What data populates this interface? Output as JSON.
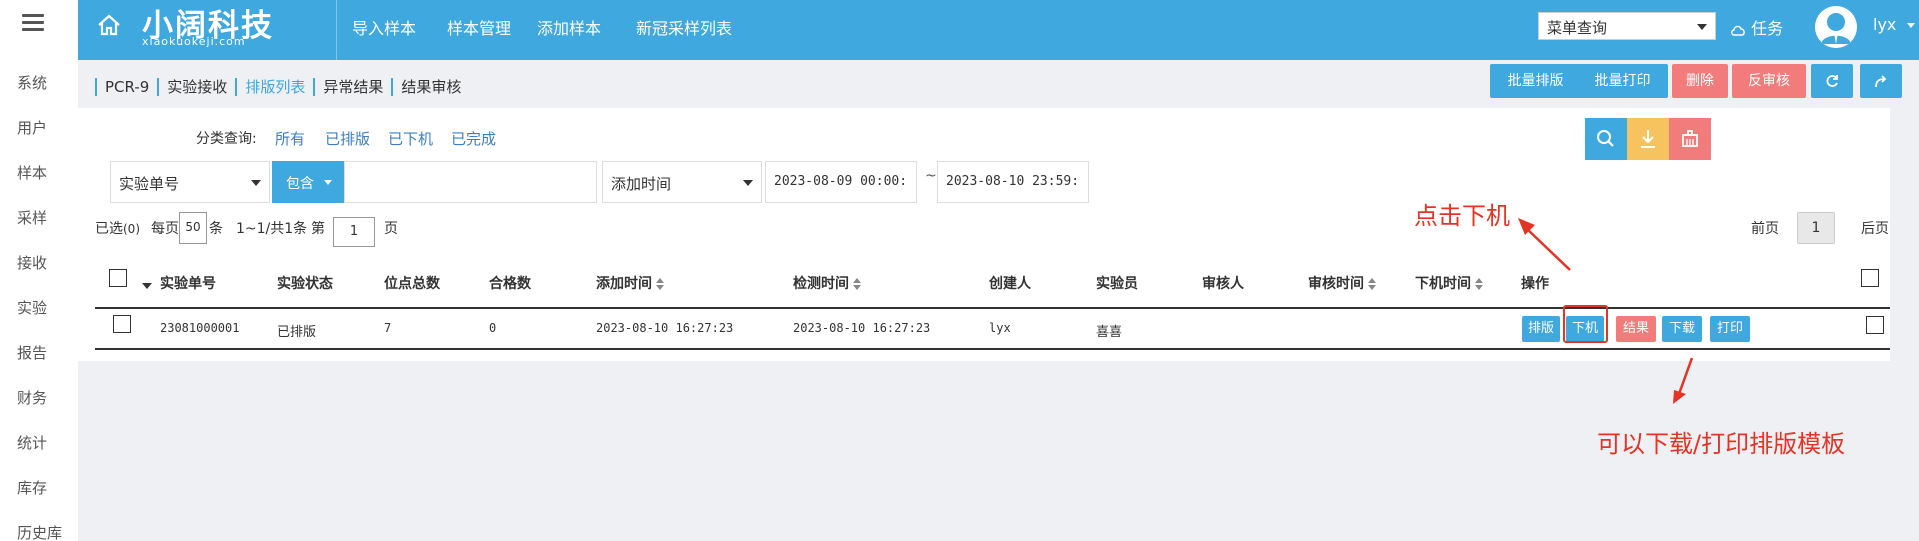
{
  "sidebar": {
    "items": [
      "系统",
      "用户",
      "样本",
      "采样",
      "接收",
      "实验",
      "报告",
      "财务",
      "统计",
      "库存",
      "历史库"
    ]
  },
  "header": {
    "logo_main": "小阔科技",
    "logo_sub": "xiaokuokeji.com",
    "nav": [
      "导入样本",
      "样本管理",
      "添加样本",
      "新冠采样列表"
    ],
    "menu_search": "菜单查询",
    "task_label": "任务",
    "user_name": "lyx"
  },
  "breadcrumb": {
    "items": [
      "PCR-9",
      "实验接收",
      "排版列表",
      "异常结果",
      "结果审核"
    ],
    "active_index": 2
  },
  "top_actions": {
    "batch_layout": "批量排版",
    "batch_print": "批量打印",
    "delete": "删除",
    "unreview": "反审核"
  },
  "filter": {
    "label": "分类查询:",
    "options": [
      "所有",
      "已排版",
      "已下机",
      "已完成"
    ]
  },
  "search": {
    "field": "实验单号",
    "operator": "包含",
    "keyword": "",
    "time_field": "添加时间",
    "date_from": "2023-08-09 00:00:",
    "tilde": "~",
    "date_to": "2023-08-10 23:59:"
  },
  "pager": {
    "selected_label": "已选",
    "selected_count": "(0)",
    "per_page_label": "每页",
    "per_page": "50",
    "per_page_unit": "条",
    "range": "1~1/共1条",
    "page_prefix": "第",
    "page_input": "1",
    "page_suffix": "页",
    "prev": "前页",
    "current": "1",
    "next": "后页"
  },
  "table": {
    "headers": [
      "实验单号",
      "实验状态",
      "位点总数",
      "合格数",
      "添加时间",
      "检测时间",
      "创建人",
      "实验员",
      "审核人",
      "审核时间",
      "下机时间",
      "操作"
    ],
    "rows": [
      {
        "id": "23081000001",
        "status": "已排版",
        "total": "7",
        "qualified": "0",
        "added": "2023-08-10 16:27:23",
        "tested": "2023-08-10 16:27:23",
        "creator": "lyx",
        "experimenter": "喜喜",
        "reviewer": "",
        "review_time": "",
        "offline_time": "",
        "actions": [
          "排版",
          "下机",
          "结果",
          "下载",
          "打印"
        ]
      }
    ]
  },
  "annotations": {
    "click_offline": "点击下机",
    "download_print": "可以下载/打印排版模板"
  },
  "colors": {
    "primary": "#3ea8df",
    "danger": "#f27c7c",
    "warning": "#f7c35f",
    "annotation": "#e53325"
  }
}
